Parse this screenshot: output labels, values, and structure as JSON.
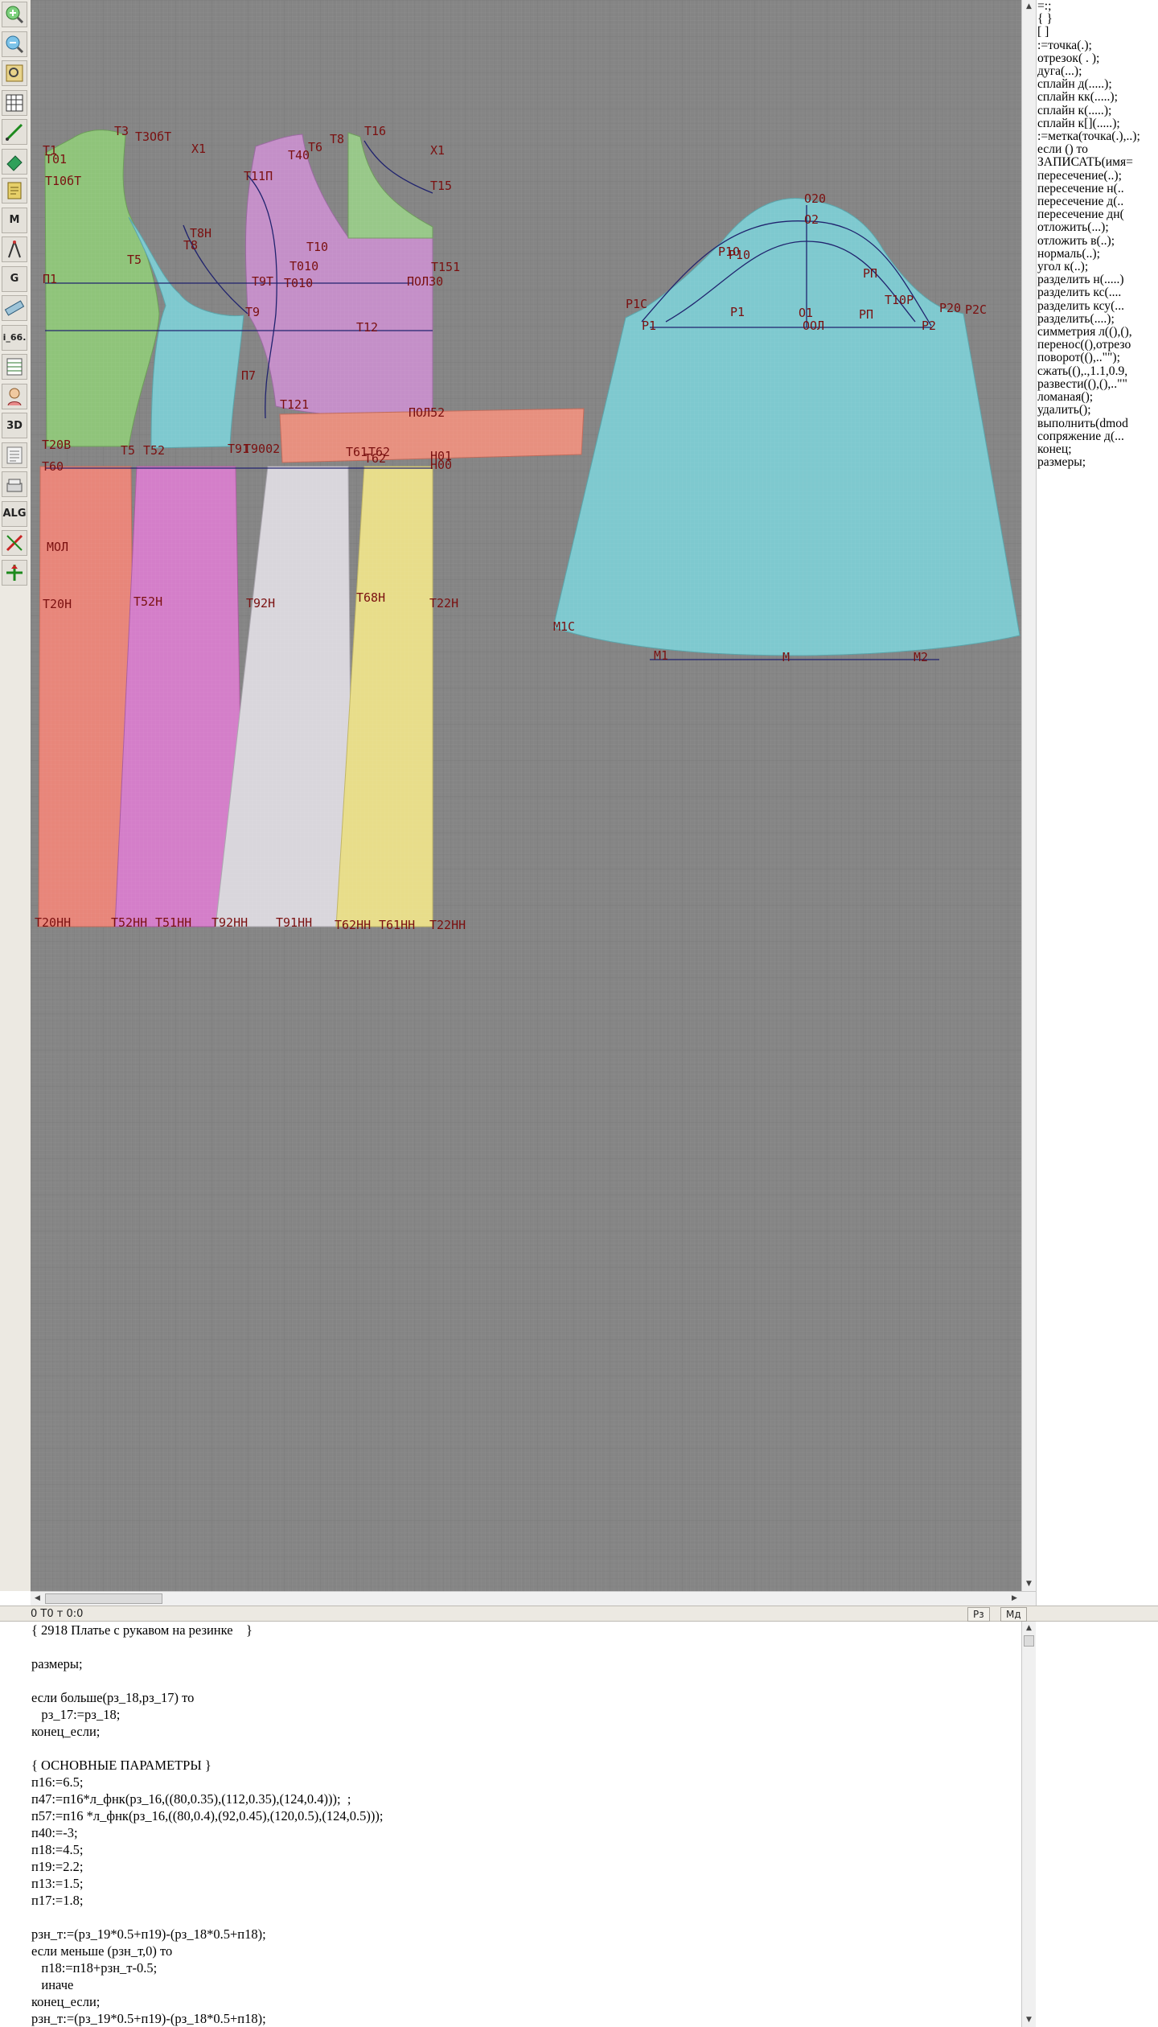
{
  "toolbar": {
    "tools": [
      {
        "icon": "zoom-in-icon"
      },
      {
        "icon": "zoom-out-icon"
      },
      {
        "icon": "zoom-window-icon"
      },
      {
        "icon": "grid-icon"
      },
      {
        "icon": "line-tool-icon"
      },
      {
        "icon": "eraser-icon"
      },
      {
        "icon": "notepad-icon"
      },
      {
        "icon": "measure-icon",
        "text": "M"
      },
      {
        "icon": "compass-icon"
      },
      {
        "icon": "gradation-icon",
        "text": "G"
      },
      {
        "icon": "ruler-icon"
      },
      {
        "icon": "size-label",
        "text": "i_66."
      },
      {
        "icon": "table-icon"
      },
      {
        "icon": "mannequin-icon"
      },
      {
        "icon": "3d-view-icon",
        "text": "3D"
      },
      {
        "icon": "list-icon"
      },
      {
        "icon": "stack-icon"
      },
      {
        "icon": "algorithm-icon",
        "text": "ALG"
      },
      {
        "icon": "cut-icon"
      },
      {
        "icon": "arrow-tool-icon"
      }
    ]
  },
  "commands": [
    "=:;",
    "{  }",
    "[  ]",
    ":=точка(.);",
    "отрезок( . );",
    "дуга(...);",
    "сплайн  д(.....);",
    "сплайн  кк(.....);",
    "сплайн  к(.....);",
    "сплайн  к[](.....);",
    ":=метка(точка(.),..);",
    "если () то",
    "ЗАПИСАТЬ(имя=",
    "пересечение(..);",
    "пересечение  н(..",
    "пересечение  д(..",
    "пересечение  дн(",
    "отложить(...);",
    "отложить  в(..);",
    "нормаль(..);",
    "угол  к(..);",
    "разделить  н(.....)",
    "разделить  кс(....",
    "разделить  ксу(...",
    "разделить(....);",
    "симметрия  л((),(),",
    "перенос((),отрезо",
    "поворот((),..\"\");",
    "сжать((),.,1.1,0.9,",
    "развести((),(),..\"\"",
    "ломаная();",
    "удалить();",
    "выполнить(dmod",
    "сопряжение  д(...",
    "конец;",
    "размеры;"
  ],
  "status": {
    "text": "0  T0 т 0:0",
    "btn1": "Рз",
    "btn2": "Мд"
  },
  "editor": {
    "lines": [
      "{ 2918 Платье с рукавом на резинке    }",
      "",
      "размеры;",
      "",
      "если больше(рз_18,рз_17) то",
      "   рз_17:=рз_18;",
      "конец_если;",
      "",
      "{ ОСНОВНЫЕ ПАРАМЕТРЫ }",
      "п16:=6.5;",
      "п47:=п16*л_фнк(рз_16,((80,0.35),(112,0.35),(124,0.4)));  ;",
      "п57:=п16 *л_фнк(рз_16,((80,0.4),(92,0.45),(120,0.5),(124,0.5)));",
      "п40:=-3;",
      "п18:=4.5;",
      "п19:=2.2;",
      "п13:=1.5;",
      "п17:=1.8;",
      "",
      "рзн_т:=(рз_19*0.5+п19)-(рз_18*0.5+п18);",
      "если меньше (рзн_т,0) то",
      "   п18:=п18+рзн_т-0.5;",
      "   иначе",
      "конец_если;",
      "рзн_т:=(рз_19*0.5+п19)-(рз_18*0.5+п18);"
    ]
  },
  "drawing": {
    "labels": [
      "Т3",
      "Т3ОбТ",
      "Т1",
      "Т01",
      "Т10бТ",
      "Х1",
      "Т6",
      "Т40",
      "Т8",
      "Т16",
      "Х1",
      "Т11П",
      "Т15",
      "Т5",
      "Т8",
      "Т8Н",
      "Т10",
      "Т010",
      "Т151",
      "П1",
      "Т9Т",
      "Т010",
      "ПОЛ30",
      "Т9",
      "Т12",
      "П7",
      "Т121",
      "ПОЛ52",
      "Т20В",
      "Т60",
      "Т5",
      "Т52",
      "Т91",
      "Т9002",
      "Т61",
      "Т62",
      "Т62",
      "Н01",
      "Н00",
      "МОЛ",
      "Т20Н",
      "Т52Н",
      "Т92Н",
      "Т68Н",
      "Т22Н",
      "Т20НН",
      "Т52НН",
      "Т51НН",
      "Т92НН",
      "Т91НН",
      "Т62НН",
      "Т61НН",
      "Т22НН",
      "О20",
      "О2",
      "Р1О",
      "Р10",
      "Р1С",
      "Р1",
      "Р1",
      "О1",
      "РП",
      "РП",
      "Т10Р",
      "Р20",
      "Р2С",
      "Р2",
      "ООЛ",
      "М1С",
      "М1",
      "М",
      "М2"
    ]
  }
}
